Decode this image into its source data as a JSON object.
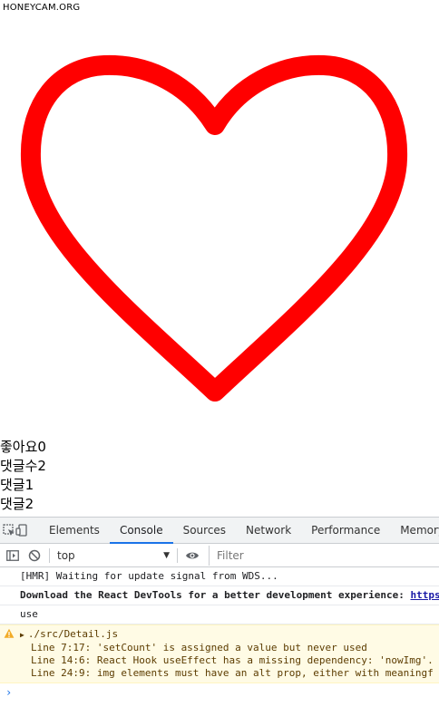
{
  "watermark": "HONEYCAM.ORG",
  "heart": {
    "color": "#ff0000",
    "icon": "heart-outline-icon"
  },
  "texts": {
    "likes": "좋아요0",
    "comment_count": "댓글수2",
    "comment1": "댓글1",
    "comment2": "댓글2"
  },
  "devtools": {
    "tabs": [
      "Elements",
      "Console",
      "Sources",
      "Network",
      "Performance",
      "Memory"
    ],
    "active_tab": "Console",
    "icons": {
      "inspect": "inspect-element-icon",
      "device": "device-toolbar-icon",
      "sidebar": "console-sidebar-icon",
      "clear": "clear-console-icon",
      "eye": "live-expression-icon"
    },
    "context": "top",
    "filter_placeholder": "Filter",
    "accent": "#1a73e8"
  },
  "console": {
    "messages": [
      "[HMR] Waiting for update signal from WDS...",
      "Download the React DevTools for a better development experience: ",
      "use"
    ],
    "devtools_link": "https",
    "warning": {
      "file": "./src/Detail.js",
      "lines": [
        "Line 7:17:  'setCount' is assigned a value but never used",
        "Line 14:6:  React Hook useEffect has a missing dependency: 'nowImg'.",
        "Line 24:9:  img elements must have an alt prop, either with meaningf"
      ]
    },
    "prompt": "›"
  }
}
